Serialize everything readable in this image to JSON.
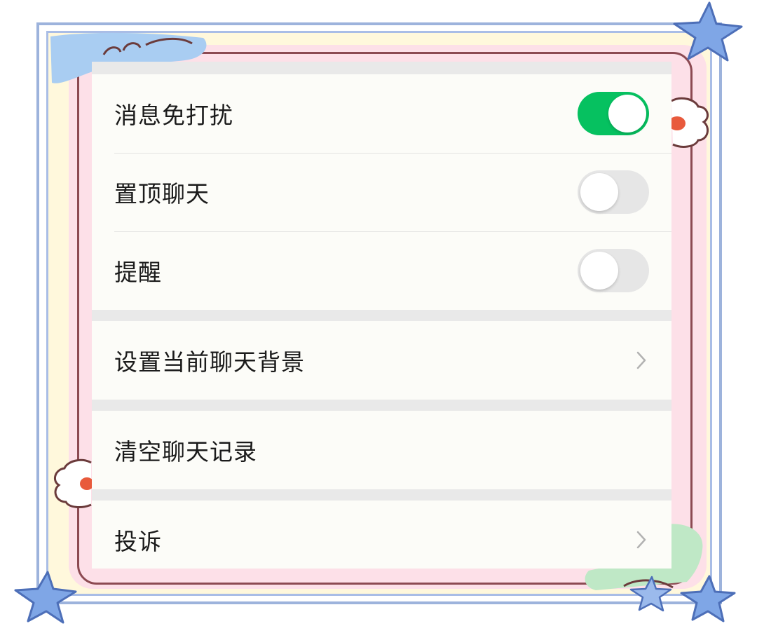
{
  "colors": {
    "toggle_on": "#06c160",
    "toggle_off": "#e6e6e6",
    "group_bg": "#fcfcf8",
    "separator_bg": "#e9e9e9",
    "chevron": "#b2b2b2"
  },
  "settings": {
    "group1": [
      {
        "label": "消息免打扰",
        "control": "toggle",
        "on": true
      },
      {
        "label": "置顶聊天",
        "control": "toggle",
        "on": false
      },
      {
        "label": "提醒",
        "control": "toggle",
        "on": false
      }
    ],
    "group2": [
      {
        "label": "设置当前聊天背景",
        "control": "chevron-right-icon"
      }
    ],
    "group3": [
      {
        "label": "清空聊天记录"
      }
    ],
    "group4": [
      {
        "label": "投诉",
        "control": "chevron-right-icon"
      }
    ]
  }
}
